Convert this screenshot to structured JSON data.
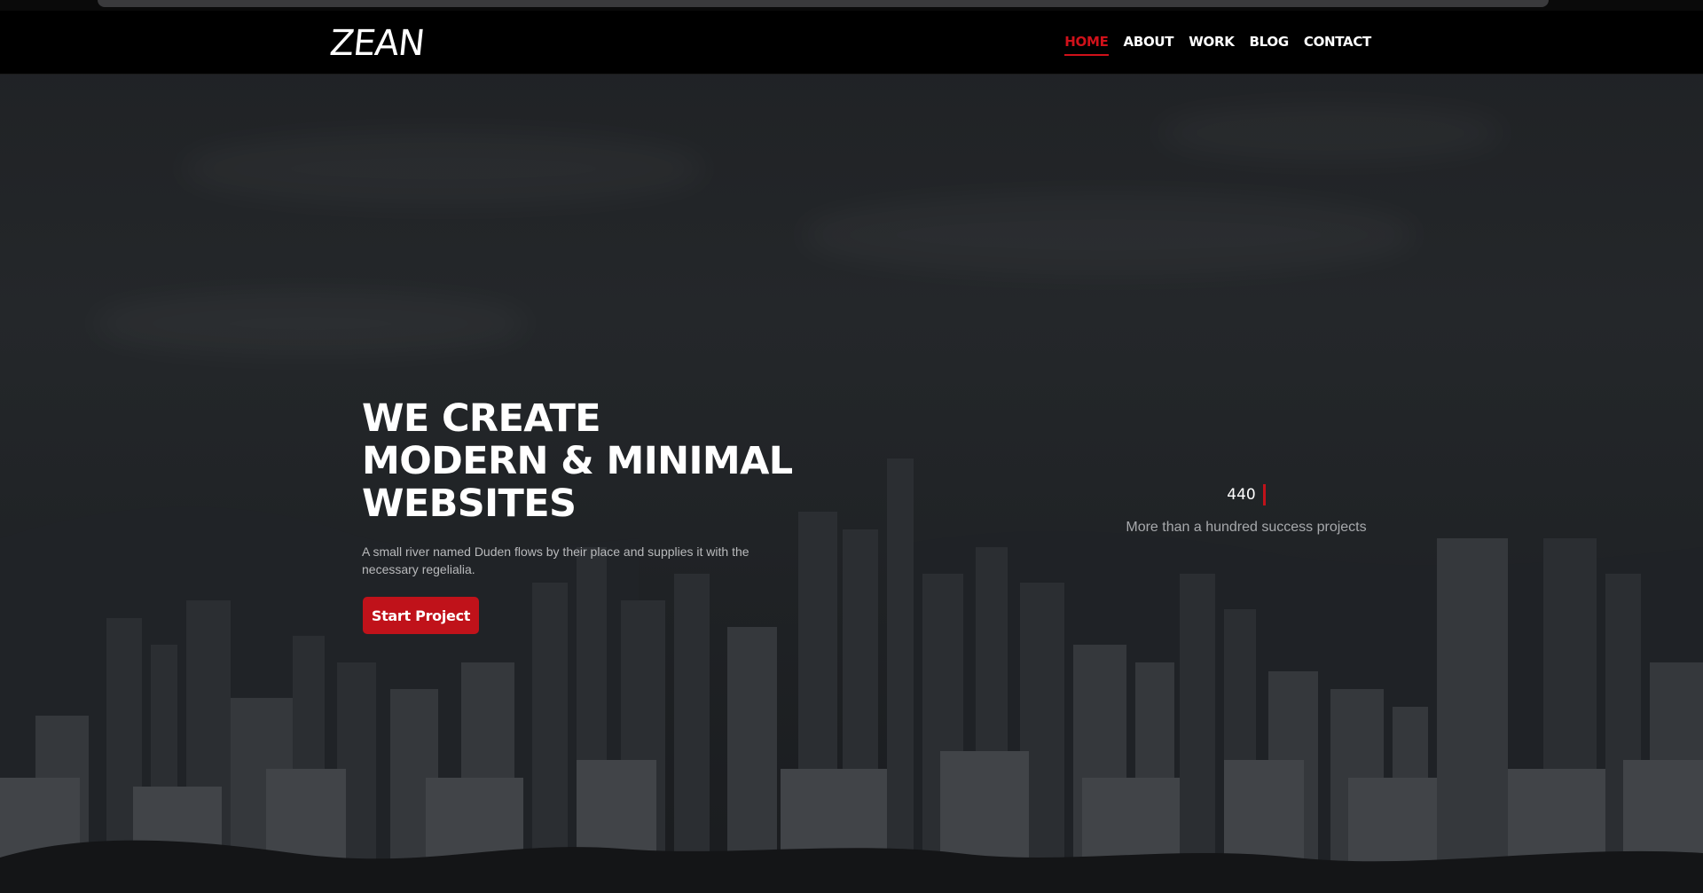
{
  "brand": {
    "logo_text": "ZEAN"
  },
  "nav": {
    "items": [
      {
        "label": "HOME",
        "active": true
      },
      {
        "label": "ABOUT",
        "active": false
      },
      {
        "label": "WORK",
        "active": false
      },
      {
        "label": "BLOG",
        "active": false
      },
      {
        "label": "CONTACT",
        "active": false
      }
    ]
  },
  "hero": {
    "title_lines": [
      "WE CREATE",
      "MODERN & MINIMAL",
      "WEBSITES"
    ],
    "description": "A small river named Duden flows by their place and supplies it with the necessary regelialia.",
    "cta_label": "Start Project"
  },
  "stat": {
    "number": "440",
    "label": "More than a hundred success projects"
  },
  "colors": {
    "accent": "#c0121a",
    "header_bg": "#000000",
    "text": "#ffffff"
  }
}
